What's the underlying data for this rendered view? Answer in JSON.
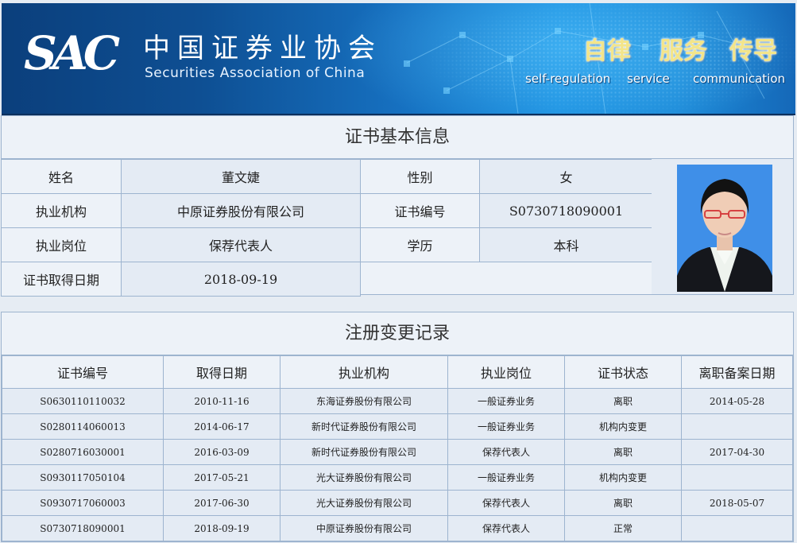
{
  "header": {
    "logo_mark": "SAC",
    "org_name_cn": "中国证券业协会",
    "org_name_en": "Securities Association of China",
    "slogans": [
      {
        "cn": "自律",
        "en": "self-regulation"
      },
      {
        "cn": "服务",
        "en": "service"
      },
      {
        "cn": "传导",
        "en": "communication"
      }
    ]
  },
  "basic_info": {
    "title": "证书基本信息",
    "fields": {
      "name_label": "姓名",
      "name_value": "董文婕",
      "gender_label": "性别",
      "gender_value": "女",
      "org_label": "执业机构",
      "org_value": "中原证券股份有限公司",
      "cert_no_label": "证书编号",
      "cert_no_value": "S0730718090001",
      "position_label": "执业岗位",
      "position_value": "保荐代表人",
      "education_label": "学历",
      "education_value": "本科",
      "cert_date_label": "证书取得日期",
      "cert_date_value": "2018-09-19"
    },
    "photo_alt": "证件照"
  },
  "records": {
    "title": "注册变更记录",
    "columns": [
      "证书编号",
      "取得日期",
      "执业机构",
      "执业岗位",
      "证书状态",
      "离职备案日期"
    ],
    "rows": [
      [
        "S0630110110032",
        "2010-11-16",
        "东海证券股份有限公司",
        "一般证券业务",
        "离职",
        "2014-05-28"
      ],
      [
        "S0280114060013",
        "2014-06-17",
        "新时代证券股份有限公司",
        "一般证券业务",
        "机构内变更",
        ""
      ],
      [
        "S0280716030001",
        "2016-03-09",
        "新时代证券股份有限公司",
        "保荐代表人",
        "离职",
        "2017-04-30"
      ],
      [
        "S0930117050104",
        "2017-05-21",
        "光大证券股份有限公司",
        "一般证券业务",
        "机构内变更",
        ""
      ],
      [
        "S0930717060003",
        "2017-06-30",
        "光大证券股份有限公司",
        "保荐代表人",
        "离职",
        "2018-05-07"
      ],
      [
        "S0730718090001",
        "2018-09-19",
        "中原证券股份有限公司",
        "保荐代表人",
        "正常",
        ""
      ]
    ]
  }
}
